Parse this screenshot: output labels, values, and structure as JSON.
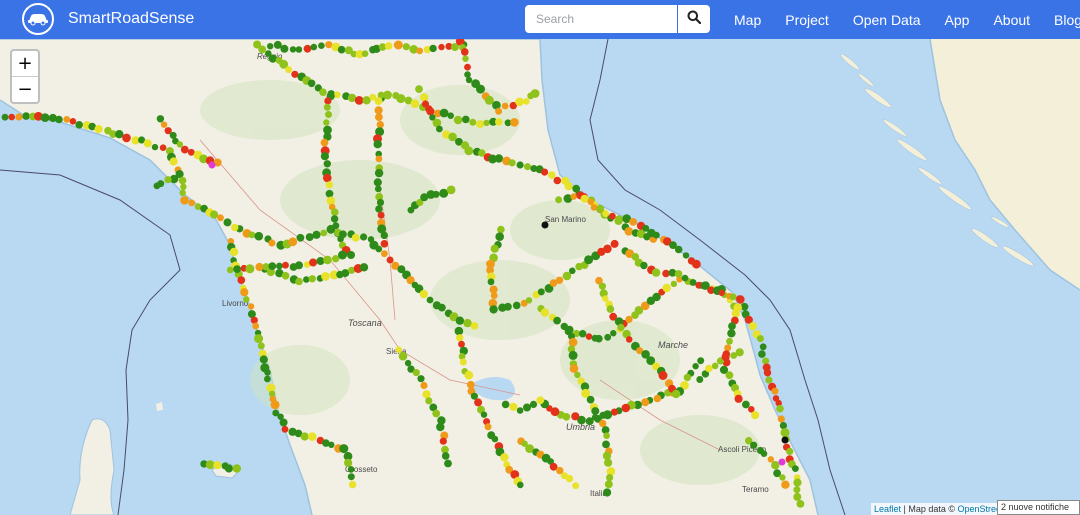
{
  "brand": {
    "name": "SmartRoadSense",
    "logo_icon": "car-icon"
  },
  "search": {
    "placeholder": "Search",
    "value": "",
    "button_icon": "search-icon"
  },
  "nav": {
    "items": [
      {
        "label": "Map"
      },
      {
        "label": "Project"
      },
      {
        "label": "Open Data"
      },
      {
        "label": "App"
      },
      {
        "label": "About"
      },
      {
        "label": "Blog"
      }
    ]
  },
  "map": {
    "zoom_in": "+",
    "zoom_out": "−",
    "labels": {
      "reggio": "Reggio",
      "toscana": "Toscana",
      "siena": "Siena",
      "livorno": "Livorno",
      "grosseto": "Grosseto",
      "marche": "Marche",
      "san_marino": "San Marino",
      "umbria": "Umbria",
      "ascoli": "Ascoli Piceno",
      "teramo": "Teramo",
      "italia": "Italia"
    }
  },
  "attribution": {
    "leaflet": "Leaflet",
    "sep": " | Map data © ",
    "osm": "OpenStreetMap"
  },
  "notification": {
    "text": "2 nuove notifiche"
  },
  "colors": {
    "navbar": "#3a73e6",
    "sea": "#b9d8f2",
    "land": "#f2efe4",
    "quality_good": "#2e8b1a",
    "quality_fair": "#8fc21a",
    "quality_medium": "#e8e22a",
    "quality_poor": "#f09a1a",
    "quality_bad": "#e2331a"
  }
}
